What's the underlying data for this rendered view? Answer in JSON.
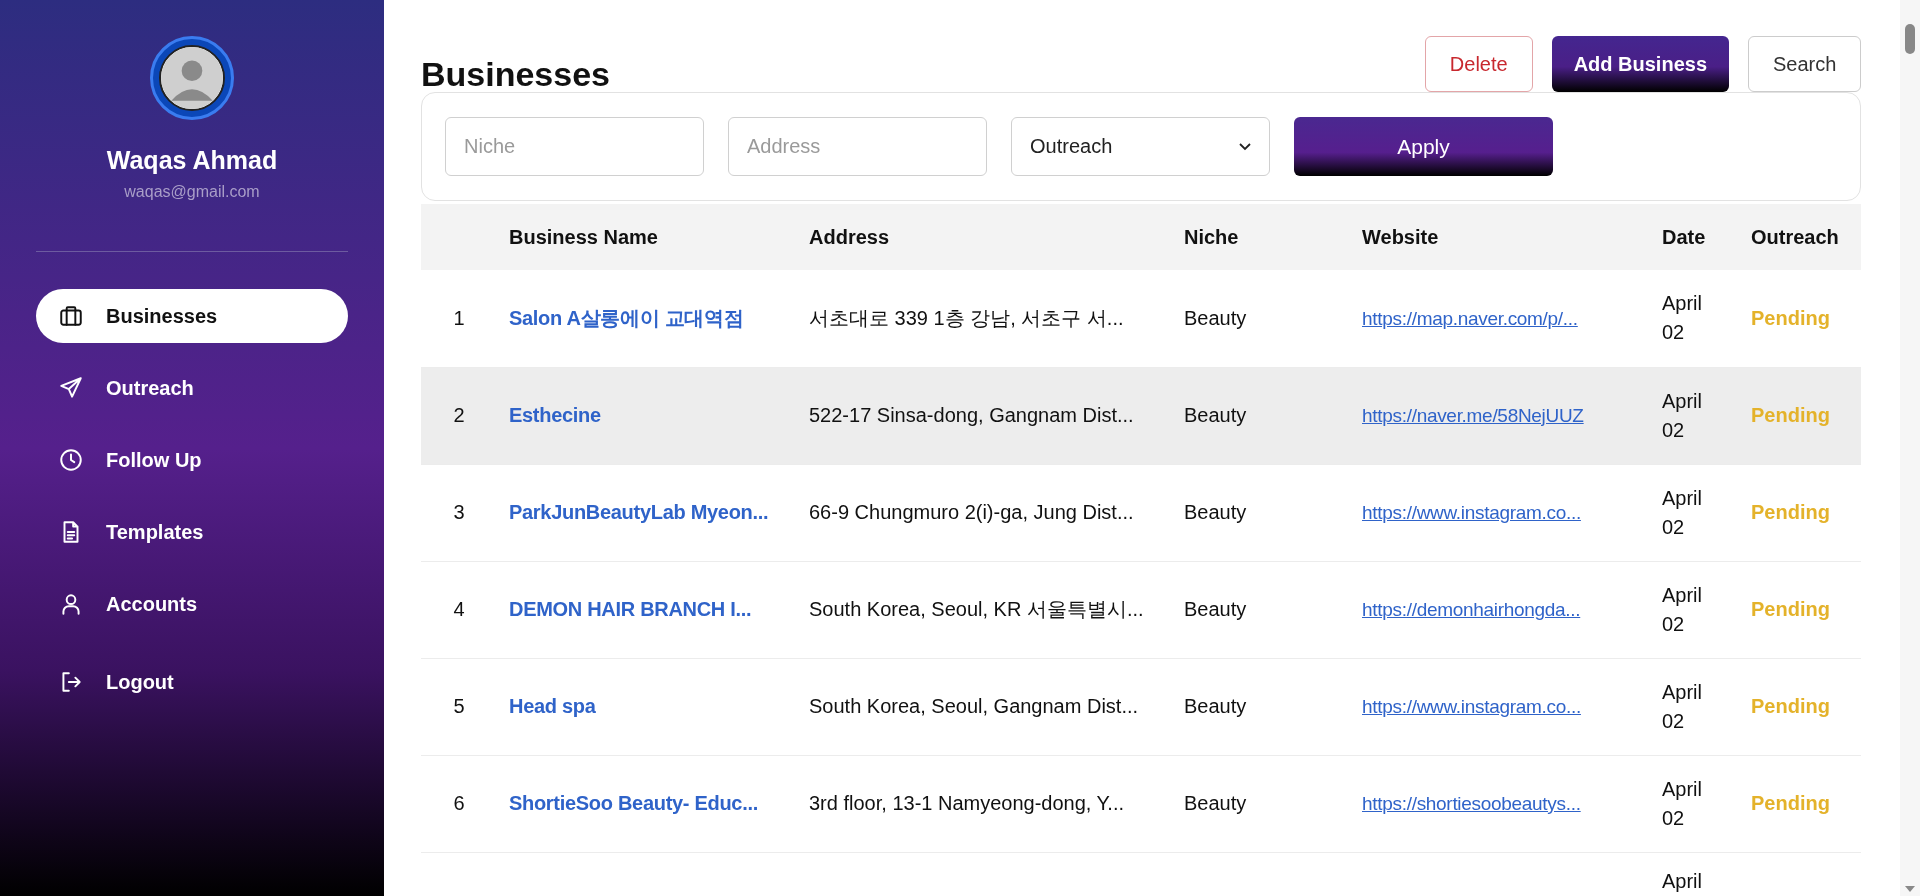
{
  "sidebar": {
    "user": {
      "name": "Waqas Ahmad",
      "email": "waqas@gmail.com"
    },
    "items": [
      {
        "label": "Businesses",
        "kind": "briefcase",
        "selected": true
      },
      {
        "label": "Outreach",
        "kind": "send",
        "selected": false
      },
      {
        "label": "Follow Up",
        "kind": "clock",
        "selected": false
      },
      {
        "label": "Templates",
        "kind": "document",
        "selected": false
      },
      {
        "label": "Accounts",
        "kind": "person",
        "selected": false
      },
      {
        "label": "Logout",
        "kind": "logout",
        "selected": false
      }
    ]
  },
  "header": {
    "title": "Businesses",
    "buttons": [
      {
        "label": "Delete",
        "kind": "danger"
      },
      {
        "label": "Add Business",
        "kind": "primary"
      },
      {
        "label": "Search",
        "kind": "plain"
      }
    ]
  },
  "filters": {
    "niche": {
      "placeholder": "Niche"
    },
    "address": {
      "placeholder": "Address"
    },
    "outreach": {
      "value": "Outreach"
    },
    "apply": "Apply"
  },
  "table": {
    "columns": [
      "Business Name",
      "Address",
      "Niche",
      "Website",
      "Date",
      "Outreach"
    ],
    "rows": [
      {
        "index": "1",
        "name": "Salon A살롱에이 교대역점",
        "address": "서초대로 339 1층 강남, 서초구 서...",
        "niche": "Beauty",
        "website": "https://map.naver.com/p/...",
        "date": "April 02",
        "outreach": "Pending",
        "highlighted": false
      },
      {
        "index": "2",
        "name": "Esthecine",
        "address": "522-17 Sinsa-dong, Gangnam Dist...",
        "niche": "Beauty",
        "website": "https://naver.me/58NejUUZ",
        "date": "April 02",
        "outreach": "Pending",
        "highlighted": true
      },
      {
        "index": "3",
        "name": "ParkJunBeautyLab Myeon...",
        "address": "66-9 Chungmuro 2(i)-ga, Jung Dist...",
        "niche": "Beauty",
        "website": "https://www.instagram.co...",
        "date": "April 02",
        "outreach": "Pending",
        "highlighted": false
      },
      {
        "index": "4",
        "name": "DEMON HAIR BRANCH I...",
        "address": "South Korea, Seoul, KR 서울특별시...",
        "niche": "Beauty",
        "website": "https://demonhairhongda...",
        "date": "April 02",
        "outreach": "Pending",
        "highlighted": false
      },
      {
        "index": "5",
        "name": "Head spa",
        "address": "South Korea, Seoul, Gangnam Dist...",
        "niche": "Beauty",
        "website": "https://www.instagram.co...",
        "date": "April 02",
        "outreach": "Pending",
        "highlighted": false
      },
      {
        "index": "6",
        "name": "ShortieSoo Beauty- Educ...",
        "address": "3rd floor, 13-1 Namyeong-dong, Y...",
        "niche": "Beauty",
        "website": "https://shortiesoobeautys...",
        "date": "April 02",
        "outreach": "Pending",
        "highlighted": false
      },
      {
        "date": "April",
        "highlighted": false
      }
    ]
  }
}
